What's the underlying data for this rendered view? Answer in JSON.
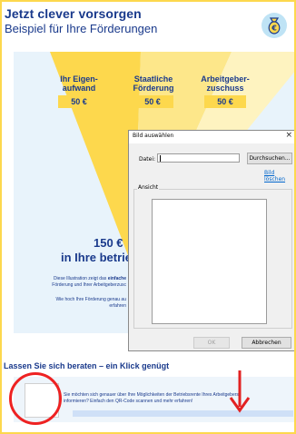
{
  "header": {
    "title": "Jetzt clever vorsorgen",
    "subtitle": "Beispiel für Ihre Förderungen"
  },
  "icons": {
    "money_bag": "money-bag-euro-icon",
    "close": "close-icon"
  },
  "colors": {
    "brand_blue": "#1a3a8c",
    "yellow": "#fdd84d",
    "light_blue": "#e8f3fb",
    "annotation_red": "#e22222"
  },
  "columns": [
    {
      "label": "Ihr Eigen-\naufwand",
      "amount": "50 €"
    },
    {
      "label": "Staatliche\nFörderung",
      "amount": "50 €"
    },
    {
      "label": "Arbeitgeber-\nzuschuss",
      "amount": "50 €"
    }
  ],
  "summary": {
    "total": "150 €",
    "line2": "in Ihre betrie"
  },
  "illustration_text": {
    "line1a": "Diese Illustration zeigt das ",
    "line1b": "einfache",
    "line2": "Förderung und Ihrer Arbeitgeberzusc",
    "line3": "Wie hoch Ihre Förderung genau au",
    "line4": "erfahren"
  },
  "beraten": {
    "heading": "Lassen Sie sich beraten – ein Klick genügt",
    "text_line1": "Sie möchten sich genauer über Ihre Möglichkeiten der Betriebsrente Ihres Arbeitgebers",
    "text_line2": "informieren? Einfach den QR-Code scannen und mehr erfahren!"
  },
  "dialog": {
    "title": "Bild auswählen",
    "close": "×",
    "file_label": "Datei:",
    "file_value": "",
    "browse": "Durchsuchen...",
    "delete_link": "Bild löschen",
    "preview_label": "Ansicht",
    "ok": "OK",
    "cancel": "Abbrechen"
  }
}
